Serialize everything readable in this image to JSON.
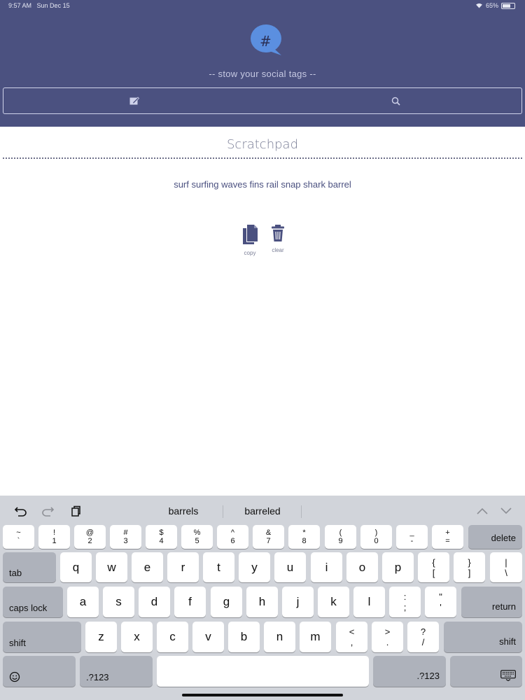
{
  "status_bar": {
    "time": "9:57 AM",
    "date": "Sun Dec 15",
    "battery": "65%"
  },
  "header": {
    "logo_glyph": "#",
    "tagline": "-- stow your social tags --",
    "colors": {
      "background": "#4b5180",
      "logo": "#5b8fe0"
    }
  },
  "toolbar": {
    "edit_icon": "edit-note-icon",
    "search_icon": "search-icon"
  },
  "scratchpad": {
    "title": "Scratchpad",
    "tags": "surf surfing waves fins rail snap shark barrel",
    "copy_label": "copy",
    "clear_label": "clear"
  },
  "keyboard": {
    "suggestions": [
      "barrels",
      "barreled"
    ],
    "number_row": [
      {
        "top": "~",
        "bottom": "`"
      },
      {
        "top": "!",
        "bottom": "1"
      },
      {
        "top": "@",
        "bottom": "2"
      },
      {
        "top": "#",
        "bottom": "3"
      },
      {
        "top": "$",
        "bottom": "4"
      },
      {
        "top": "%",
        "bottom": "5"
      },
      {
        "top": "^",
        "bottom": "6"
      },
      {
        "top": "&",
        "bottom": "7"
      },
      {
        "top": "*",
        "bottom": "8"
      },
      {
        "top": "(",
        "bottom": "9"
      },
      {
        "top": ")",
        "bottom": "0"
      },
      {
        "top": "_",
        "bottom": "-"
      },
      {
        "top": "+",
        "bottom": "="
      }
    ],
    "delete": "delete",
    "tab": "tab",
    "row_q": [
      "q",
      "w",
      "e",
      "r",
      "t",
      "y",
      "u",
      "i",
      "o",
      "p"
    ],
    "bracket_keys": [
      {
        "top": "{",
        "bottom": "["
      },
      {
        "top": "}",
        "bottom": "]"
      },
      {
        "top": "|",
        "bottom": "\\"
      }
    ],
    "caps_lock": "caps lock",
    "row_a": [
      "a",
      "s",
      "d",
      "f",
      "g",
      "h",
      "j",
      "k",
      "l"
    ],
    "punct_a": [
      {
        "top": ":",
        "bottom": ";"
      },
      {
        "top": "\"",
        "bottom": "'"
      }
    ],
    "return": "return",
    "shift": "shift",
    "row_z": [
      "z",
      "x",
      "c",
      "v",
      "b",
      "n",
      "m"
    ],
    "punct_z": [
      {
        "top": "<",
        "bottom": ","
      },
      {
        "top": ">",
        "bottom": "."
      },
      {
        "top": "?",
        "bottom": "/"
      }
    ],
    "symbols": ".?123"
  }
}
